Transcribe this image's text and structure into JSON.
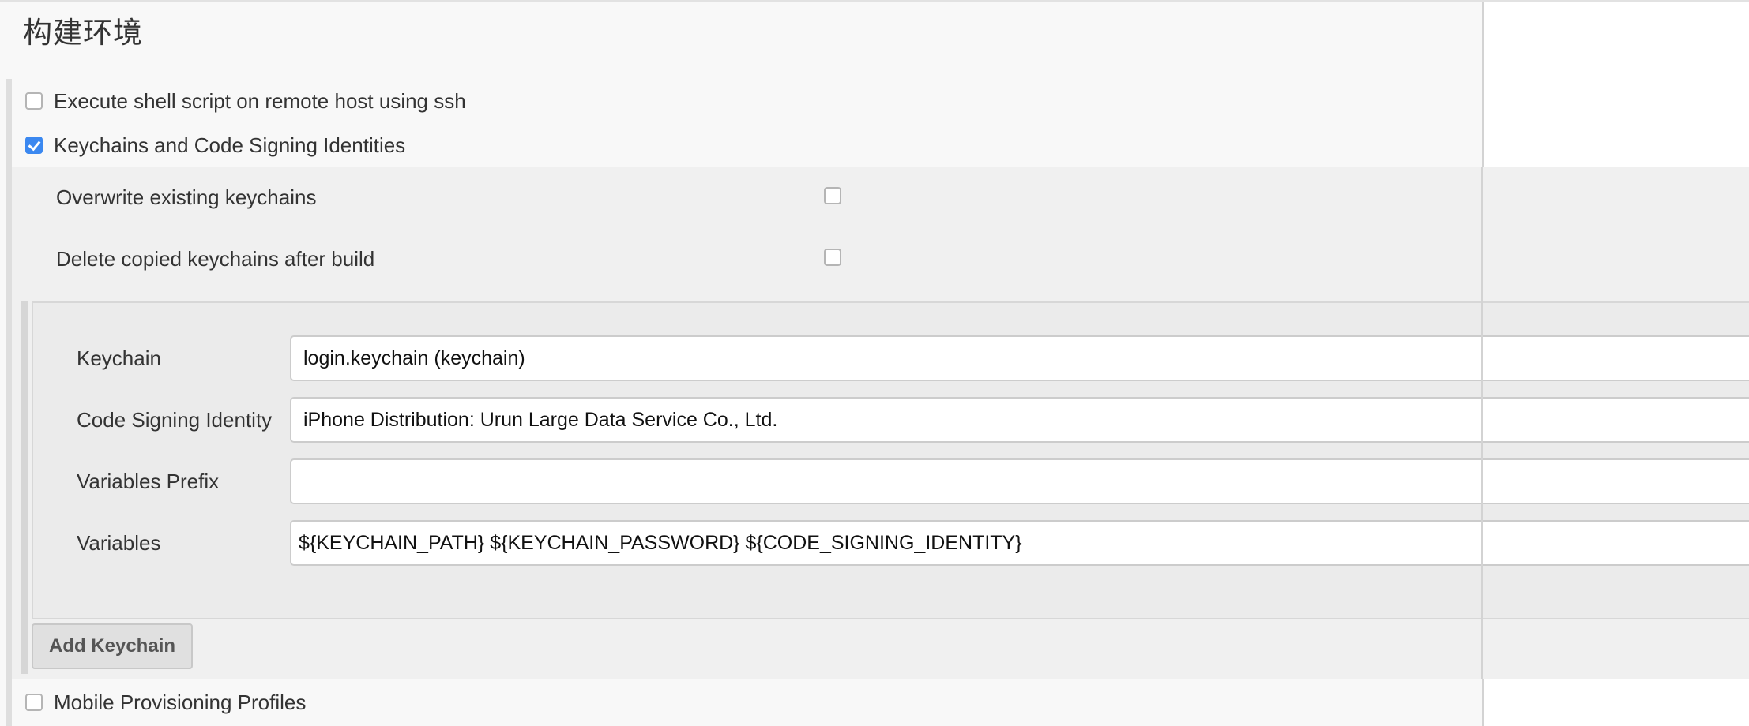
{
  "section": {
    "title": "构建环境"
  },
  "options": {
    "ssh_remote": {
      "label": "Execute shell script on remote host using ssh",
      "checked": false
    },
    "keychains": {
      "label": "Keychains and Code Signing Identities",
      "checked": true
    },
    "mobile_profiles": {
      "label": "Mobile Provisioning Profiles",
      "checked": false
    }
  },
  "keychain_options": {
    "overwrite": {
      "label": "Overwrite existing keychains",
      "checked": false
    },
    "delete_copied": {
      "label": "Delete copied keychains after build",
      "checked": false
    }
  },
  "keychain_entry": {
    "keychain": {
      "label": "Keychain",
      "value": "login.keychain (keychain)"
    },
    "identity": {
      "label": "Code Signing Identity",
      "value": "iPhone Distribution: Urun Large Data Service Co., Ltd."
    },
    "prefix": {
      "label": "Variables Prefix",
      "value": ""
    },
    "variables": {
      "label": "Variables",
      "value": "${KEYCHAIN_PATH} ${KEYCHAIN_PASSWORD} ${CODE_SIGNING_IDENTITY}"
    }
  },
  "buttons": {
    "add_keychain": "Add Keychain"
  },
  "colors": {
    "checkbox_checked": "#3b88f0",
    "background": "#f8f8f8",
    "nested_background": "#f0f0f0",
    "keychain_box_background": "#ebebeb"
  }
}
